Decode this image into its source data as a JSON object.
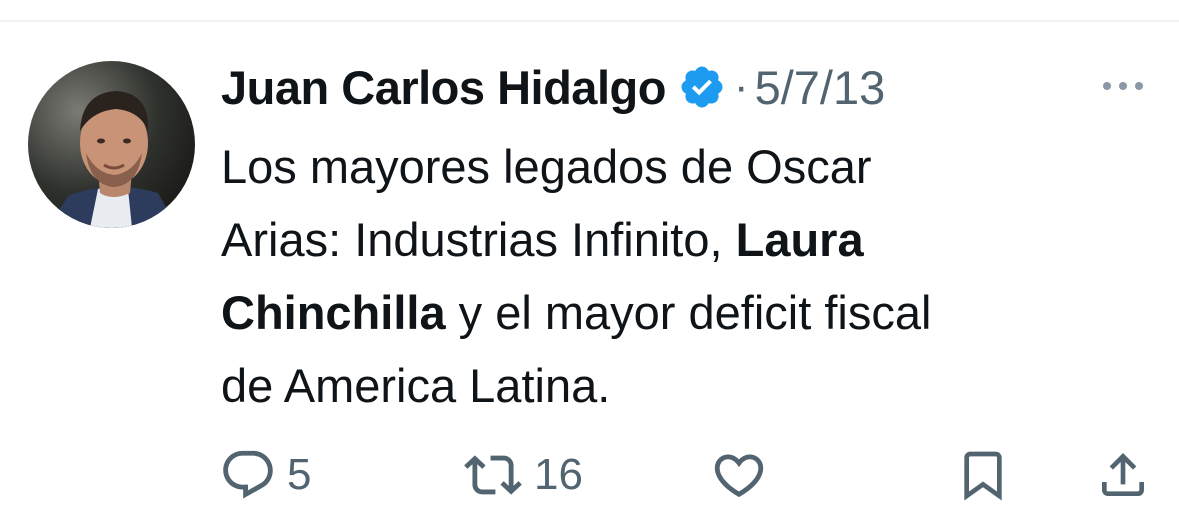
{
  "tweet": {
    "author_name": "Juan Carlos Hidalgo",
    "separator": "·",
    "timestamp": "5/7/13",
    "verified_icon": "verified-badge-icon",
    "text_line1": "Los mayores legados de Oscar",
    "text_line2_part1": "Arias: Industrias Infinito, ",
    "text_line2_bold": "Laura",
    "text_line3_bold": "Chinchilla",
    "text_line3_part2": " y el mayor deficit fiscal",
    "text_line4": "de America Latina."
  },
  "actions": {
    "reply_count": "5",
    "retweet_count": "16",
    "like_count": "",
    "icons": [
      "reply-icon",
      "retweet-icon",
      "like-icon",
      "bookmark-icon",
      "share-icon",
      "more-icon"
    ]
  },
  "colors": {
    "text_primary": "#0f1419",
    "text_secondary": "#536471",
    "verified_blue": "#1d9bf0",
    "divider": "#eff3f4"
  }
}
